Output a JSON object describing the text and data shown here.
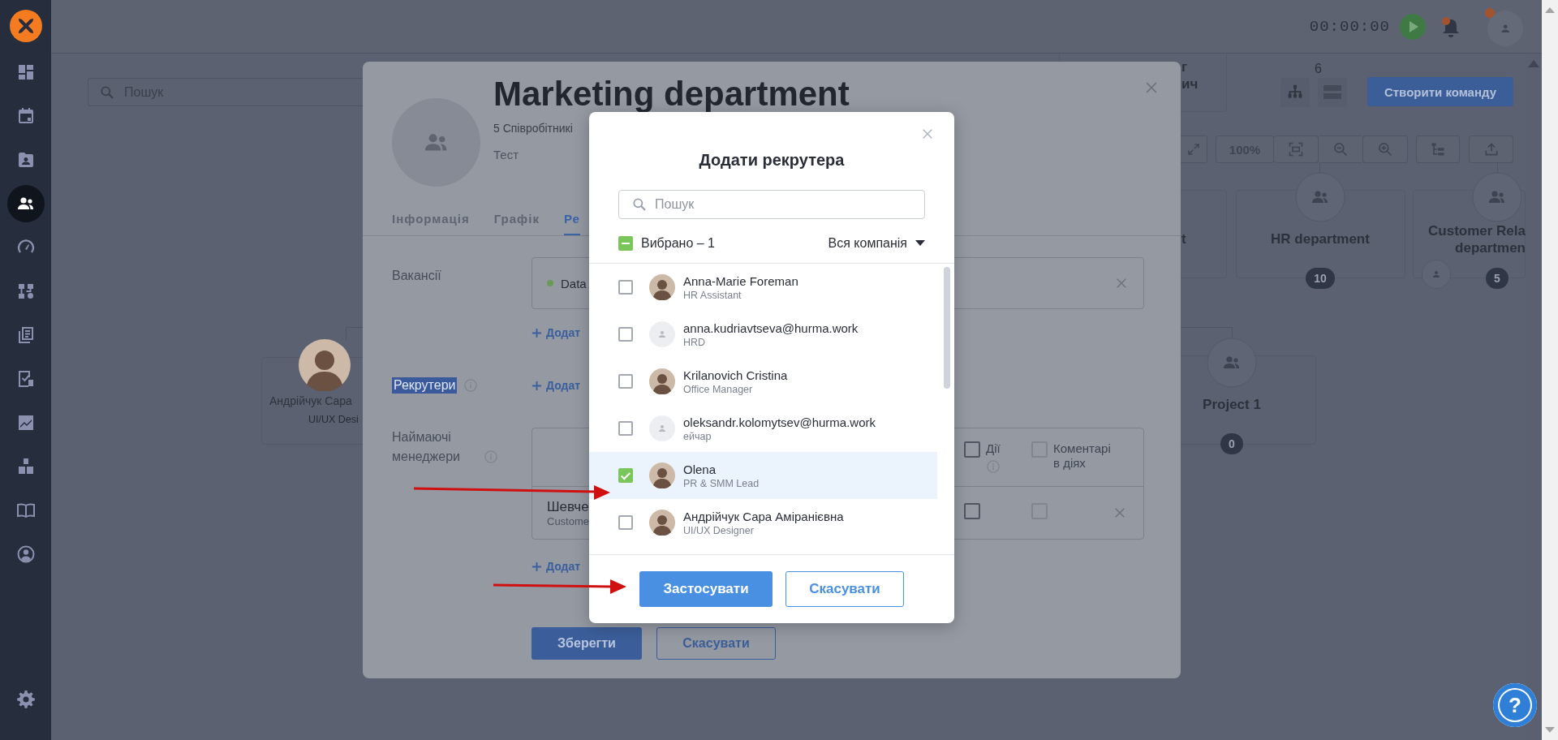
{
  "sidebar": {
    "items": [
      {
        "kind": "dashboard",
        "selected": false
      },
      {
        "kind": "calendar",
        "selected": false
      },
      {
        "kind": "contacts",
        "selected": false
      },
      {
        "kind": "team",
        "selected": true
      },
      {
        "kind": "gauge",
        "selected": false
      },
      {
        "kind": "workflow",
        "selected": false
      },
      {
        "kind": "documents",
        "selected": false
      },
      {
        "kind": "tasks",
        "selected": false
      },
      {
        "kind": "chart",
        "selected": false
      },
      {
        "kind": "boxes",
        "selected": false
      },
      {
        "kind": "book",
        "selected": false
      },
      {
        "kind": "account",
        "selected": false
      },
      {
        "kind": "settings",
        "selected": false
      }
    ]
  },
  "top_bar": {
    "timer": "00:00:00"
  },
  "org_chart": {
    "search": {
      "placeholder": "Пошук"
    },
    "team_count": "6",
    "create_button": "Створити команду",
    "zoom": "100%",
    "nodes": [
      {
        "kind": "fragment",
        "lines": [
          "г",
          "ич"
        ]
      },
      {
        "kind": "fragment",
        "lines": [
          "t"
        ]
      },
      {
        "kind": "team",
        "lines": [
          "HR department"
        ],
        "count": "10"
      },
      {
        "kind": "team",
        "lines": [
          "Customer Rela",
          "departmen"
        ],
        "count": "5"
      },
      {
        "kind": "person",
        "lines": [
          "Андрійчук Сара",
          "UI/UX Desi"
        ]
      },
      {
        "kind": "team",
        "lines": [
          "Project 1"
        ],
        "count": "0"
      }
    ]
  },
  "team_modal": {
    "title": "Marketing department",
    "subtitle": "5 Співробітникі",
    "description": "Тест",
    "tabs": [
      {
        "label": "Інформація",
        "selected": false
      },
      {
        "label": "Графік",
        "selected": false
      },
      {
        "label": "Ре",
        "selected": true
      }
    ],
    "vacancies": {
      "label": "Вакансії",
      "item": {
        "text": "Data",
        "color": "#6a9a5a"
      },
      "add": "Додат"
    },
    "recruiters": {
      "label": "Рекрутери",
      "highlighted": true,
      "add": "Додат"
    },
    "managers": {
      "label": "Наймаючі менеджери",
      "columns": [
        {
          "label": "Дії",
          "checked": false,
          "disabled": false,
          "info": true
        },
        {
          "label": "Коментарі в діях",
          "checked": false,
          "disabled": true,
          "info": false
        }
      ],
      "rows": [
        {
          "name": "Шевче",
          "role": "Custome",
          "cells": [
            {
              "checked": false,
              "disabled": false
            },
            {
              "checked": false,
              "disabled": true
            }
          ]
        }
      ],
      "add": "Додат"
    },
    "buttons": [
      {
        "label": "Зберегти",
        "kind": "primary"
      },
      {
        "label": "Скасувати",
        "kind": "secondary"
      }
    ]
  },
  "recruiter_dialog": {
    "title": "Додати рекрутера",
    "search": {
      "placeholder": "Пошук"
    },
    "select_all": {
      "label": "Вибрано – 1",
      "indeterminate": true
    },
    "filter": "Вся компанія",
    "people": [
      {
        "name": "Anna-Marie Foreman",
        "role": "HR Assistant",
        "kind": "photo",
        "checked": false
      },
      {
        "name": "anna.kudriavtseva@hurma.work",
        "role": "HRD",
        "kind": "placeholder",
        "checked": false
      },
      {
        "name": "Krilanovich Cristina",
        "role": "Office Manager",
        "kind": "photo",
        "checked": false
      },
      {
        "name": "oleksandr.kolomytsev@hurma.work",
        "role": "ейчар",
        "kind": "placeholder",
        "checked": false
      },
      {
        "name": "Olena",
        "role": "PR & SMM Lead",
        "kind": "photo",
        "checked": true
      },
      {
        "name": "Андрійчук Сара Аміранієвна",
        "role": "UI/UX Designer",
        "kind": "photo",
        "checked": false
      }
    ],
    "buttons": [
      {
        "label": "Застосувати",
        "kind": "primary"
      },
      {
        "label": "Скасувати",
        "kind": "secondary"
      }
    ]
  },
  "help_button": "?"
}
